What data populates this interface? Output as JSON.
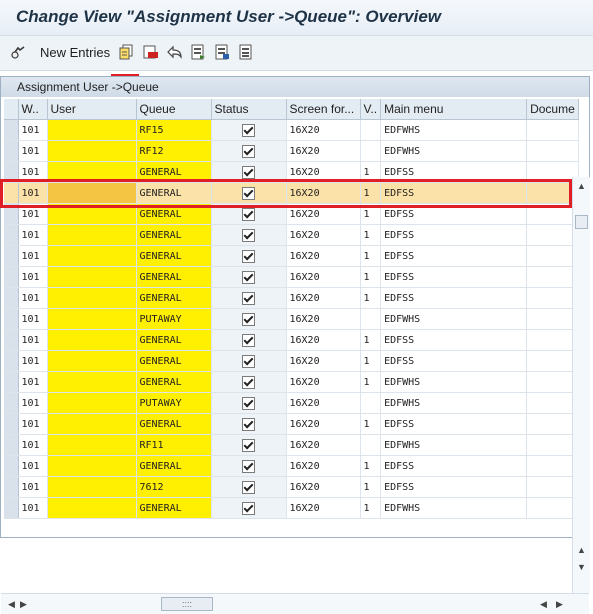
{
  "window": {
    "title": "Change View \"Assignment User ->Queue\": Overview"
  },
  "toolbar": {
    "new_entries_label": "New Entries",
    "icons": [
      "glasses-icon",
      "copy-icon",
      "delete-icon",
      "undo-icon",
      "select-all-icon",
      "select-block-icon",
      "deselect-all-icon"
    ]
  },
  "panel": {
    "title": "Assignment User ->Queue"
  },
  "table": {
    "columns": [
      "W..",
      "User",
      "Queue",
      "Status",
      "Screen for...",
      "V..",
      "Main menu",
      "Docume"
    ],
    "rows": [
      {
        "w": "101",
        "user": "",
        "queue": "RF15",
        "status": true,
        "screen": "16X20",
        "v": "",
        "menu": "EDFWHS",
        "doc": ""
      },
      {
        "w": "101",
        "user": "",
        "queue": "RF12",
        "status": true,
        "screen": "16X20",
        "v": "",
        "menu": "EDFWHS",
        "doc": ""
      },
      {
        "w": "101",
        "user": "",
        "queue": "GENERAL",
        "status": true,
        "screen": "16X20",
        "v": "1",
        "menu": "EDFSS",
        "doc": ""
      },
      {
        "w": "101",
        "user": "",
        "queue": "GENERAL",
        "status": true,
        "screen": "16X20",
        "v": "1",
        "menu": "EDFSS",
        "doc": ""
      },
      {
        "w": "101",
        "user": "",
        "queue": "GENERAL",
        "status": true,
        "screen": "16X20",
        "v": "1",
        "menu": "EDFSS",
        "doc": ""
      },
      {
        "w": "101",
        "user": "",
        "queue": "GENERAL",
        "status": true,
        "screen": "16X20",
        "v": "1",
        "menu": "EDFSS",
        "doc": ""
      },
      {
        "w": "101",
        "user": "",
        "queue": "GENERAL",
        "status": true,
        "screen": "16X20",
        "v": "1",
        "menu": "EDFSS",
        "doc": ""
      },
      {
        "w": "101",
        "user": "",
        "queue": "GENERAL",
        "status": true,
        "screen": "16X20",
        "v": "1",
        "menu": "EDFSS",
        "doc": ""
      },
      {
        "w": "101",
        "user": "",
        "queue": "GENERAL",
        "status": true,
        "screen": "16X20",
        "v": "1",
        "menu": "EDFSS",
        "doc": ""
      },
      {
        "w": "101",
        "user": "",
        "queue": "PUTAWAY",
        "status": true,
        "screen": "16X20",
        "v": "",
        "menu": "EDFWHS",
        "doc": ""
      },
      {
        "w": "101",
        "user": "",
        "queue": "GENERAL",
        "status": true,
        "screen": "16X20",
        "v": "1",
        "menu": "EDFSS",
        "doc": ""
      },
      {
        "w": "101",
        "user": "",
        "queue": "GENERAL",
        "status": true,
        "screen": "16X20",
        "v": "1",
        "menu": "EDFSS",
        "doc": ""
      },
      {
        "w": "101",
        "user": "",
        "queue": "GENERAL",
        "status": true,
        "screen": "16X20",
        "v": "1",
        "menu": "EDFWHS",
        "doc": ""
      },
      {
        "w": "101",
        "user": "",
        "queue": "PUTAWAY",
        "status": true,
        "screen": "16X20",
        "v": "",
        "menu": "EDFWHS",
        "doc": ""
      },
      {
        "w": "101",
        "user": "",
        "queue": "GENERAL",
        "status": true,
        "screen": "16X20",
        "v": "1",
        "menu": "EDFSS",
        "doc": ""
      },
      {
        "w": "101",
        "user": "",
        "queue": "RF11",
        "status": true,
        "screen": "16X20",
        "v": "",
        "menu": "EDFWHS",
        "doc": ""
      },
      {
        "w": "101",
        "user": "",
        "queue": "GENERAL",
        "status": true,
        "screen": "16X20",
        "v": "1",
        "menu": "EDFSS",
        "doc": ""
      },
      {
        "w": "101",
        "user": "",
        "queue": "7612",
        "status": true,
        "screen": "16X20",
        "v": "1",
        "menu": "EDFSS",
        "doc": ""
      },
      {
        "w": "101",
        "user": "",
        "queue": "GENERAL",
        "status": true,
        "screen": "16X20",
        "v": "1",
        "menu": "EDFWHS",
        "doc": ""
      }
    ],
    "highlighted_row_index": 3
  },
  "scrollbars": {
    "h_thumb_glyph": "::::"
  },
  "colors": {
    "accent_red": "#e01e25",
    "user_column_yellow": "#ffef00",
    "highlight_row": "#fbe2a8"
  }
}
